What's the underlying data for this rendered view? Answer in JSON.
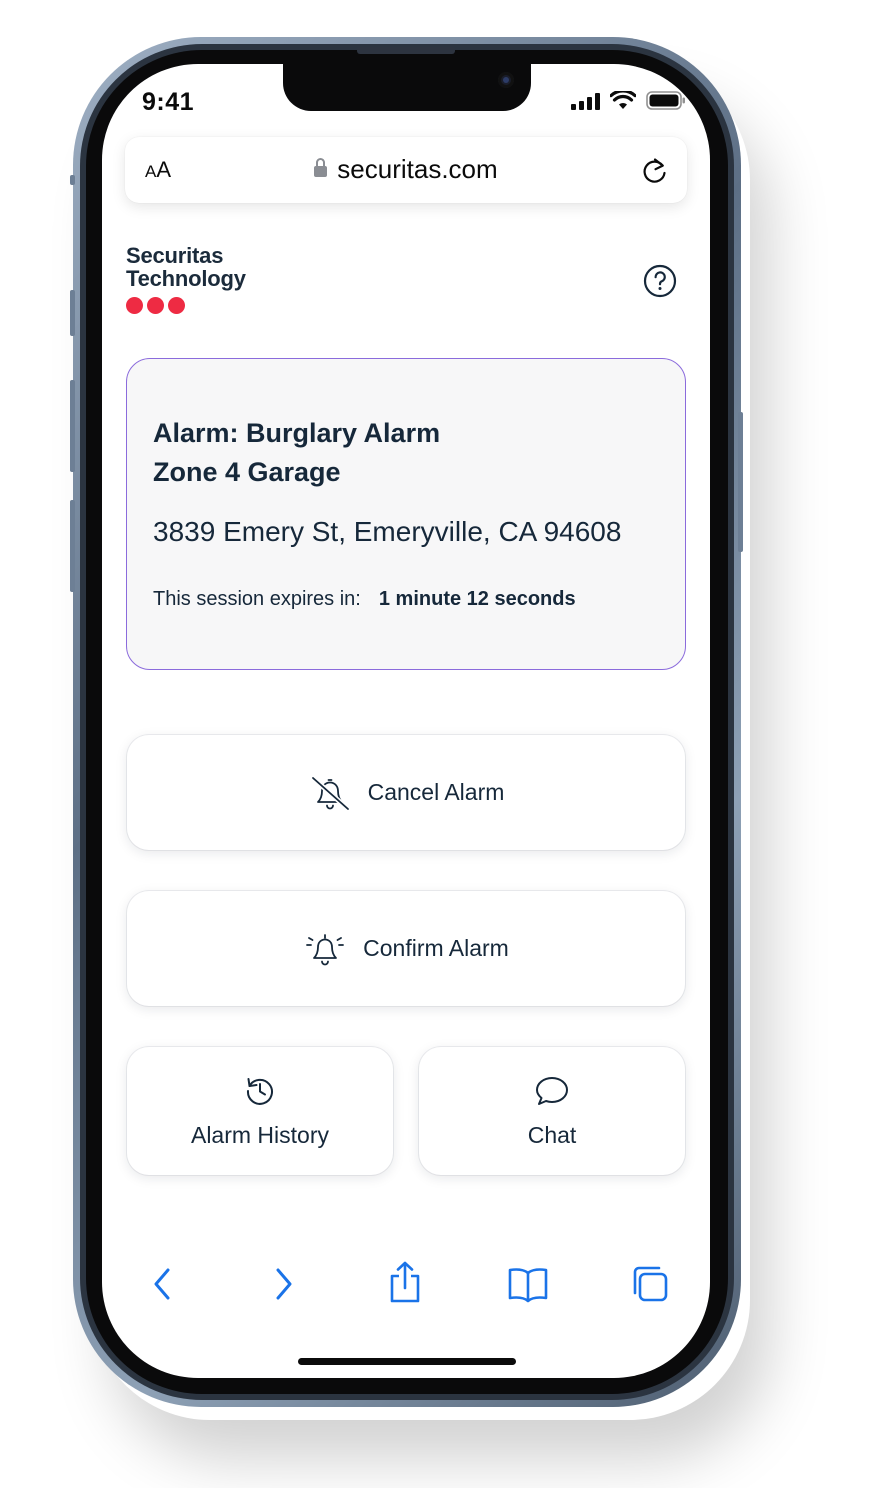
{
  "status_bar": {
    "time": "9:41"
  },
  "browser": {
    "text_size_small": "A",
    "text_size_large": "A",
    "url": "securitas.com"
  },
  "brand": {
    "line1": "Securitas",
    "line2": "Technology",
    "dot_color": "#ee2b43"
  },
  "alarm": {
    "title_line1": "Alarm: Burglary Alarm",
    "title_line2": "Zone 4 Garage",
    "address": "3839 Emery St, Emeryville, CA 94608",
    "session_label": "This session expires in:",
    "session_value": "1 minute 12 seconds",
    "border_color": "#8b6bdc"
  },
  "actions": {
    "cancel_label": "Cancel Alarm",
    "confirm_label": "Confirm Alarm",
    "history_label": "Alarm History",
    "chat_label": "Chat"
  },
  "toolbar": {
    "icons": [
      "back-icon",
      "forward-icon",
      "share-icon",
      "bookmarks-icon",
      "tabs-icon"
    ],
    "accent_color": "#1a73e8"
  }
}
